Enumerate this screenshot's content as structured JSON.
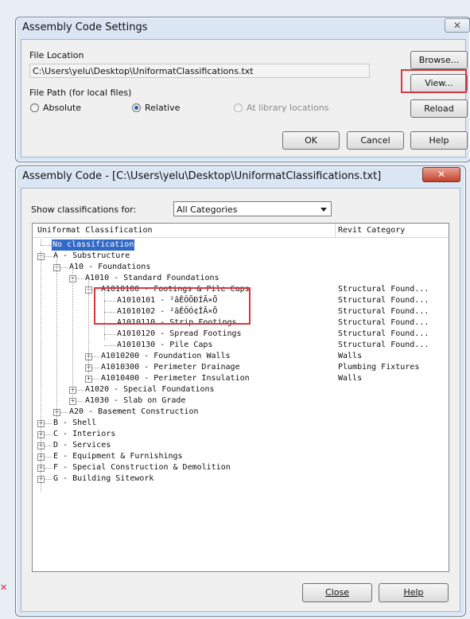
{
  "settings_dialog": {
    "title": "Assembly Code Settings",
    "close_glyph": "✕",
    "file_location_label": "File Location",
    "file_location_value": "C:\\Users\\yelu\\Desktop\\UniformatClassifications.txt",
    "file_path_label": "File Path (for local files)",
    "radio_absolute": "Absolute",
    "radio_relative": "Relative",
    "radio_library": "At library locations",
    "selected_radio": "Relative",
    "browse_label": "Browse...",
    "view_label": "View...",
    "reload_label": "Reload",
    "ok_label": "OK",
    "cancel_label": "Cancel",
    "help_label": "Help"
  },
  "code_dialog": {
    "title": "Assembly Code - [C:\\Users\\yelu\\Desktop\\UniformatClassifications.txt]",
    "close_glyph": "✕",
    "show_label": "Show classifications for:",
    "show_value": "All Categories",
    "col_classification": "Uniformat Classification",
    "col_category": "Revit Category",
    "close_label": "Close",
    "help_label": "Help",
    "rows": [
      {
        "text": "No classification",
        "category": ""
      },
      {
        "text": "A - Substructure",
        "category": ""
      },
      {
        "text": "A10 - Foundations",
        "category": ""
      },
      {
        "text": "A1010 - Standard Foundations",
        "category": ""
      },
      {
        "text": "A1010100 - Footings & Pile Caps",
        "category": "Structural Found..."
      },
      {
        "text": "A1010101 - ²âÊÔÕÐÍÃ×Õ",
        "category": "Structural Found..."
      },
      {
        "text": "A1010102 - ²âÊÔÓ¢ÎÃ×Õ",
        "category": "Structural Found..."
      },
      {
        "text": "A1010110 - Strip Footings",
        "category": "Structural Found..."
      },
      {
        "text": "A1010120 - Spread Footings",
        "category": "Structural Found..."
      },
      {
        "text": "A1010130 - Pile Caps",
        "category": "Structural Found..."
      },
      {
        "text": "A1010200 - Foundation Walls",
        "category": "Walls"
      },
      {
        "text": "A1010300 - Perimeter Drainage",
        "category": "Plumbing Fixtures"
      },
      {
        "text": "A1010400 - Perimeter Insulation",
        "category": "Walls"
      },
      {
        "text": "A1020 - Special Foundations",
        "category": ""
      },
      {
        "text": "A1030 - Slab on Grade",
        "category": ""
      },
      {
        "text": "A20 - Basement Construction",
        "category": ""
      },
      {
        "text": "B - Shell",
        "category": ""
      },
      {
        "text": "C - Interiors",
        "category": ""
      },
      {
        "text": "D - Services",
        "category": ""
      },
      {
        "text": "E - Equipment & Furnishings",
        "category": ""
      },
      {
        "text": "F - Special Construction & Demolition",
        "category": ""
      },
      {
        "text": "G - Building Sitework",
        "category": ""
      }
    ]
  }
}
